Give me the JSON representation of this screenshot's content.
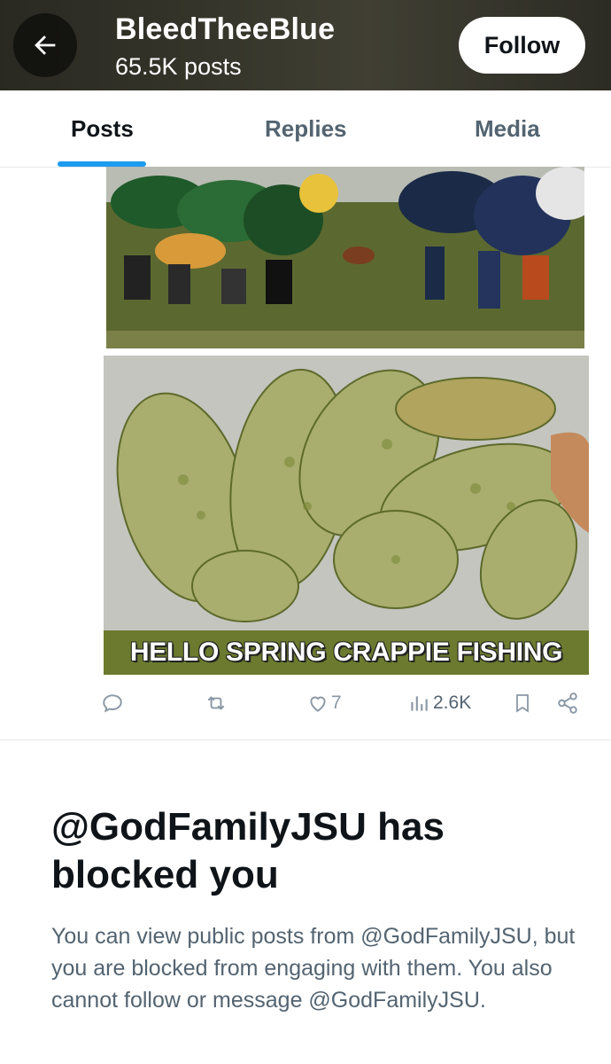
{
  "header": {
    "title": "BleedTheeBlue",
    "subtitle": "65.5K posts",
    "follow_label": "Follow",
    "back_icon": "arrow-left-icon"
  },
  "tabs": [
    {
      "label": "Posts",
      "active": true
    },
    {
      "label": "Replies",
      "active": false
    },
    {
      "label": "Media",
      "active": false
    }
  ],
  "post": {
    "image_caption": "HELLO SPRING CRAPPIE FISHING",
    "actions": {
      "reply_icon": "reply-icon",
      "repost_icon": "repost-icon",
      "like_icon": "heart-icon",
      "like_count": "7",
      "views_icon": "views-icon",
      "views_count": "2.6K",
      "bookmark_icon": "bookmark-icon",
      "share_icon": "share-icon"
    }
  },
  "blocked": {
    "title": "@GodFamilyJSU has blocked you",
    "body": "You can view public posts from @GodFamilyJSU, but you are blocked from engaging with them. You also cannot follow or message @GodFamilyJSU."
  },
  "colors": {
    "accent": "#1d9bf0",
    "text_primary": "#0f1419",
    "text_secondary": "#536471",
    "icon_gray": "#8b98a5"
  }
}
